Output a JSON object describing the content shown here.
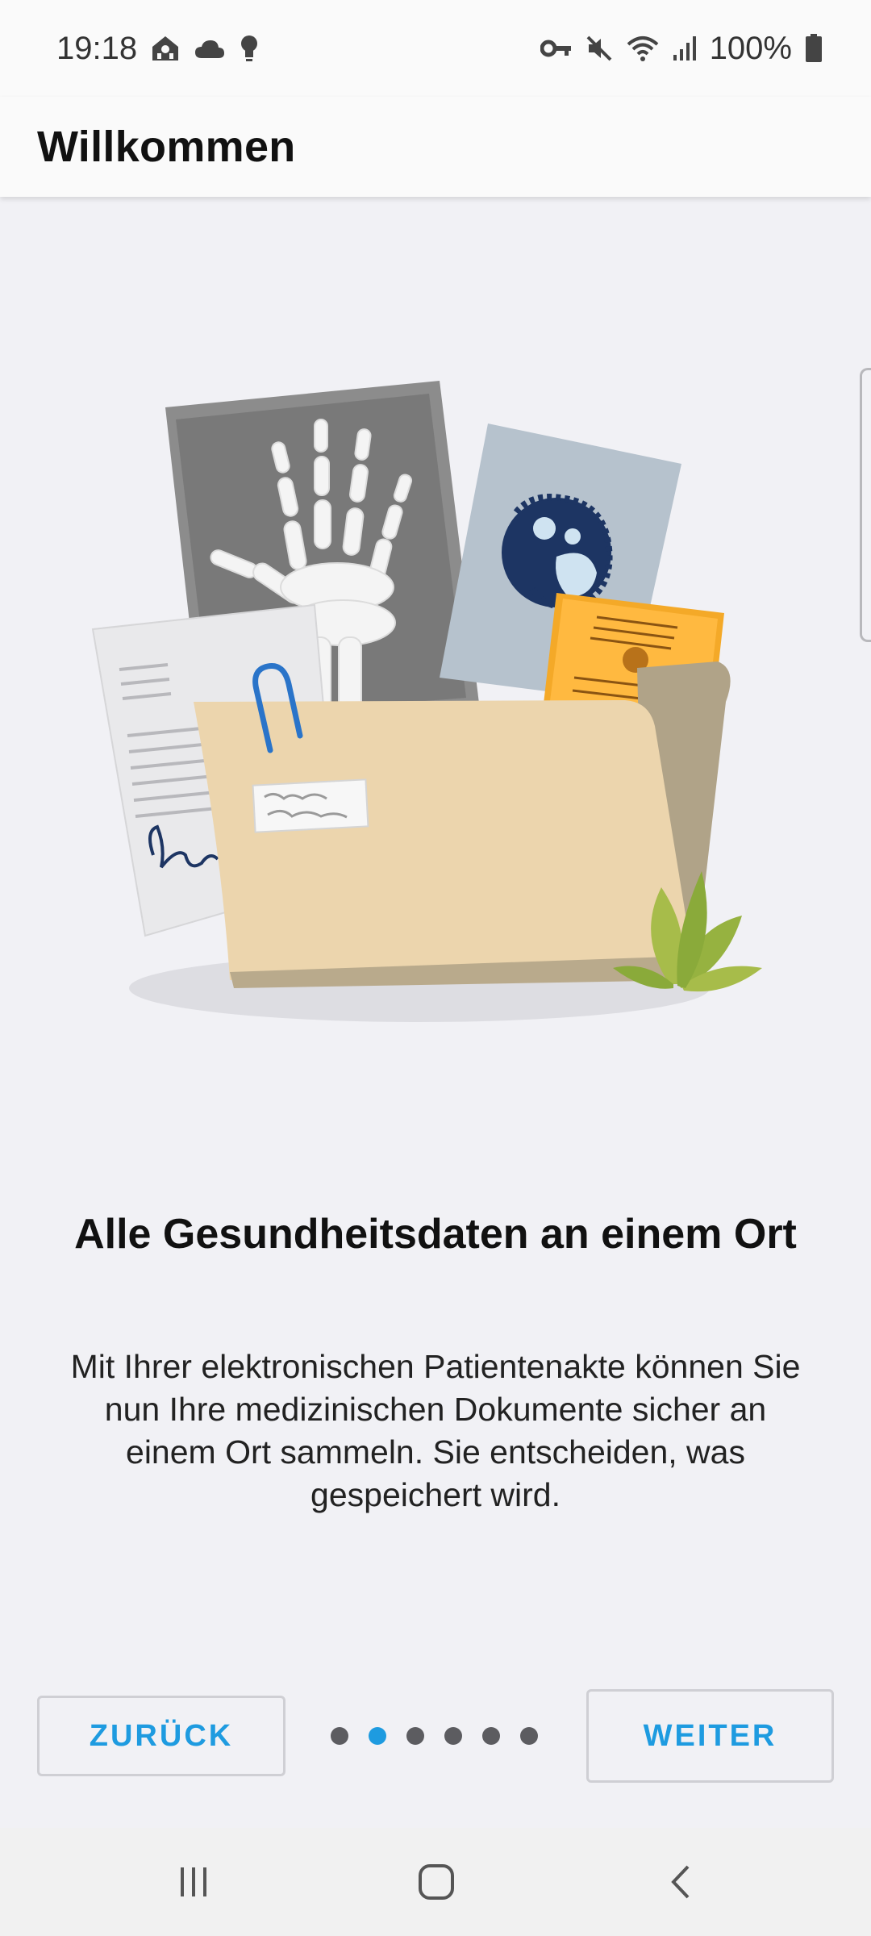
{
  "status_bar": {
    "time": "19:18",
    "battery": "100%",
    "left_icons": [
      "home-network-icon",
      "cloud-icon",
      "lightbulb-icon"
    ],
    "right_icons": [
      "vpn-key-icon",
      "mute-icon",
      "wifi-icon",
      "signal-icon",
      "battery-icon"
    ]
  },
  "app_bar": {
    "title": "Willkommen"
  },
  "onboarding": {
    "headline": "Alle Gesundheitsdaten an einem Ort",
    "description": "Mit Ihrer elektronischen Patientenakte können Sie nun Ihre medizinischen Dokumente sicher an einem Ort sammeln. Sie entscheiden, was gespeichert wird.",
    "illustration": "medical-documents-folder-illustration",
    "page_current": 2,
    "page_total": 6
  },
  "controls": {
    "back_label": "ZURÜCK",
    "next_label": "WEITER"
  },
  "colors": {
    "accent": "#1e9be0",
    "background": "#f1f1f5",
    "folder": "#ecd5ad",
    "certificate": "#ffb940"
  },
  "nav_bar": {
    "icons": [
      "recent-apps-icon",
      "home-icon",
      "back-icon"
    ]
  }
}
